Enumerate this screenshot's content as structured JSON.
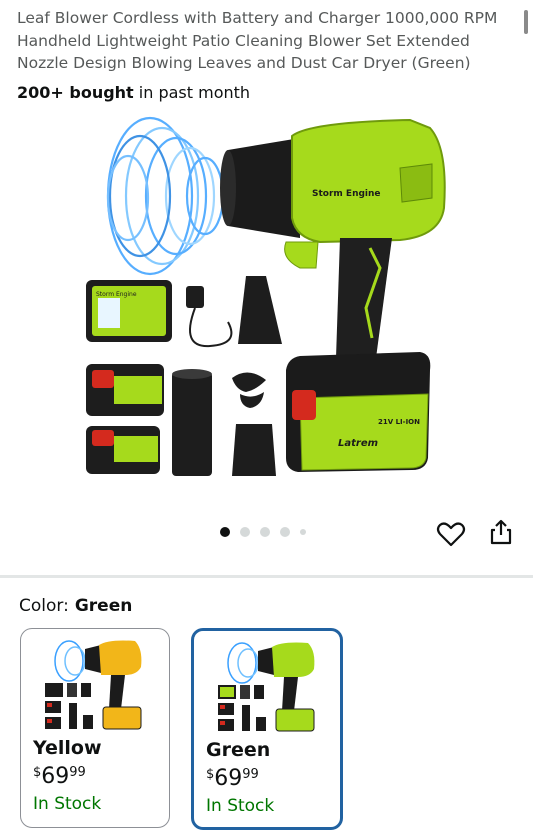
{
  "product": {
    "title": "Leaf Blower Cordless with Battery and Charger 1000,000 RPM Handheld Lightweight Patio Cleaning Blower Set Extended Nozzle Design Blowing Leaves and Dust Car Dryer (Green)",
    "bought_bold": "200+ bought",
    "bought_rest": " in past month",
    "image_labels": {
      "engine": "Storm Engine",
      "brand": "Latrem",
      "battery": "21V LI-ION",
      "case_label": "Storm Engine"
    }
  },
  "gallery": {
    "image_count": 5,
    "active_index": 0
  },
  "colors": {
    "accent": "#9bd21a",
    "selected_border": "#2162a1",
    "in_stock": "#007600"
  },
  "variants": {
    "label": "Color:",
    "selected_value": "Green",
    "options": [
      {
        "name": "Yellow",
        "currency": "$",
        "whole": "69",
        "cents": "99",
        "stock": "In Stock"
      },
      {
        "name": "Green",
        "currency": "$",
        "whole": "69",
        "cents": "99",
        "stock": "In Stock"
      }
    ]
  },
  "icons": [
    "heart-icon",
    "share-icon"
  ]
}
